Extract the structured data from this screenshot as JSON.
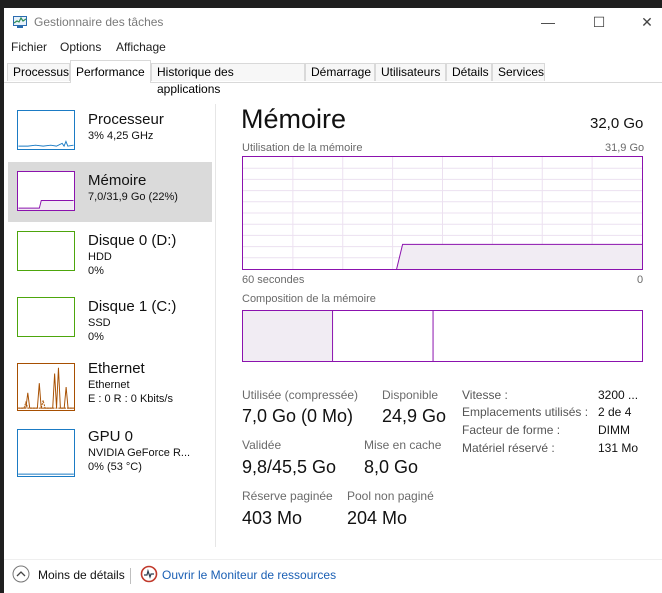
{
  "window": {
    "title": "Gestionnaire des tâches",
    "controls": {
      "minimize": "—",
      "maximize": "☐",
      "close": "✕"
    }
  },
  "menu": [
    "Fichier",
    "Options",
    "Affichage"
  ],
  "tabs": [
    {
      "label": "Processus",
      "active": false
    },
    {
      "label": "Performance",
      "active": true
    },
    {
      "label": "Historique des applications",
      "active": false
    },
    {
      "label": "Démarrage",
      "active": false
    },
    {
      "label": "Utilisateurs",
      "active": false
    },
    {
      "label": "Détails",
      "active": false
    },
    {
      "label": "Services",
      "active": false
    }
  ],
  "resources": [
    {
      "name": "Processeur",
      "sub1": "3% 4,25 GHz",
      "sub2": "",
      "color": "#1b7bc4",
      "selected": false,
      "icon": "cpu-graph"
    },
    {
      "name": "Mémoire",
      "sub1": "7,0/31,9 Go (22%)",
      "sub2": "",
      "color": "#8b12ae",
      "selected": true,
      "icon": "memory-graph"
    },
    {
      "name": "Disque 0 (D:)",
      "sub1": "HDD",
      "sub2": "0%",
      "color": "#4da60c",
      "selected": false,
      "icon": "disk-graph"
    },
    {
      "name": "Disque 1 (C:)",
      "sub1": "SSD",
      "sub2": "0%",
      "color": "#4da60c",
      "selected": false,
      "icon": "disk-graph"
    },
    {
      "name": "Ethernet",
      "sub1": "Ethernet",
      "sub2": "E : 0 R : 0 Kbits/s",
      "color": "#a74f01",
      "selected": false,
      "icon": "network-graph"
    },
    {
      "name": "GPU 0",
      "sub1": "NVIDIA GeForce R...",
      "sub2": "0% (53 °C)",
      "color": "#1b7bc4",
      "selected": false,
      "icon": "gpu-graph"
    }
  ],
  "memory": {
    "title": "Mémoire",
    "total": "32,0 Go",
    "usage_label": "Utilisation de la mémoire",
    "usage_max": "31,9 Go",
    "time_left": "60 secondes",
    "time_right": "0",
    "usage_fraction": 0.22,
    "composition_label": "Composition de la mémoire",
    "stats": {
      "in_use_label": "Utilisée (compressée)",
      "in_use_value": "7,0 Go (0 Mo)",
      "available_label": "Disponible",
      "available_value": "24,9 Go",
      "committed_label": "Validée",
      "committed_value": "9,8/45,5 Go",
      "cached_label": "Mise en cache",
      "cached_value": "8,0 Go",
      "paged_label": "Réserve paginée",
      "paged_value": "403 Mo",
      "nonpaged_label": "Pool non paginé",
      "nonpaged_value": "204 Mo"
    },
    "info": [
      {
        "label": "Vitesse :",
        "value": "3200 ..."
      },
      {
        "label": "Emplacements utilisés :",
        "value": "2 de 4"
      },
      {
        "label": "Facteur de forme :",
        "value": "DIMM"
      },
      {
        "label": "Matériel réservé :",
        "value": "131 Mo"
      }
    ],
    "accent": "#8b12ae",
    "fill": "#f1ecf3"
  },
  "footer": {
    "less_details": "Moins de détails",
    "resource_monitor": "Ouvrir le Moniteur de ressources"
  }
}
